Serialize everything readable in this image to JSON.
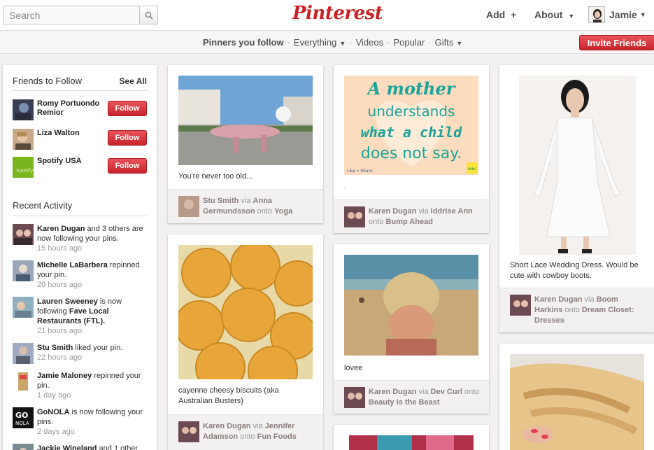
{
  "header": {
    "search_placeholder": "Search",
    "logo": "Pinterest",
    "add": "Add",
    "about": "About",
    "user": "Jamie"
  },
  "subnav": {
    "items": [
      "Pinners you follow",
      "Everything",
      "Videos",
      "Popular",
      "Gifts"
    ],
    "invite": "Invite Friends"
  },
  "sidebar": {
    "friends_title": "Friends to Follow",
    "see_all": "See All",
    "follow_label": "Follow",
    "friends": [
      {
        "name": "Romy Portuondo Remior"
      },
      {
        "name": "Liza Walton"
      },
      {
        "name": "Spotify USA"
      }
    ],
    "activity_title": "Recent Activity",
    "activity": [
      {
        "actor": "Karen Dugan",
        "text": " and 3 others are now following your pins.",
        "extra": "3 others",
        "time": "15 hours ago"
      },
      {
        "actor": "Michelle LaBarbera",
        "text": " repinned your pin.",
        "time": "20 hours ago"
      },
      {
        "actor": "Lauren Sweeney",
        "text": " is now following ",
        "target": "Fave Local Restaurants (FTL).",
        "time": "21 hours ago"
      },
      {
        "actor": "Stu Smith",
        "text": " liked your pin.",
        "time": "22 hours ago"
      },
      {
        "actor": "Jamie Maloney",
        "text": " repinned your pin.",
        "time": "1 day ago"
      },
      {
        "actor": "GoNOLA",
        "text": " is now following your pins.",
        "time": "2 days ago"
      },
      {
        "actor": "Jackie Wineland",
        "text": " and 1 other",
        "time": ""
      }
    ]
  },
  "pins": [
    {
      "desc": "You're never too old...",
      "user": "Stu Smith",
      "via": "Anna Germundsson",
      "board": "Yoga"
    },
    {
      "desc": "cayenne cheesy biscuits (aka Australian Busters)",
      "user": "Karen Dugan",
      "via": "Jennifer Adamson",
      "board": "Fun Foods"
    },
    {
      "desc": ".",
      "user": "Karen Dugan",
      "via": "Iddrise Ann",
      "board": "Bump Ahead",
      "quote": [
        "A mother",
        "understands",
        "what a child",
        "does not say."
      ]
    },
    {
      "desc": "lovee",
      "user": "Karen Dugan",
      "via": "Dev Curl",
      "board": "Beauty is the Beast"
    },
    {
      "desc": "Short Lace Wedding Dress. Would be cute with cowboy boots.",
      "user": "Karen Dugan",
      "via": "Boom Harkins",
      "board": "Dream Closet: Dresses"
    }
  ],
  "labels": {
    "via": "via",
    "onto": "onto",
    "like_share": "Like • Share",
    "kids": "kids!"
  },
  "colors": {
    "brand_red": "#cb2027",
    "background": "#f2f0f0"
  }
}
